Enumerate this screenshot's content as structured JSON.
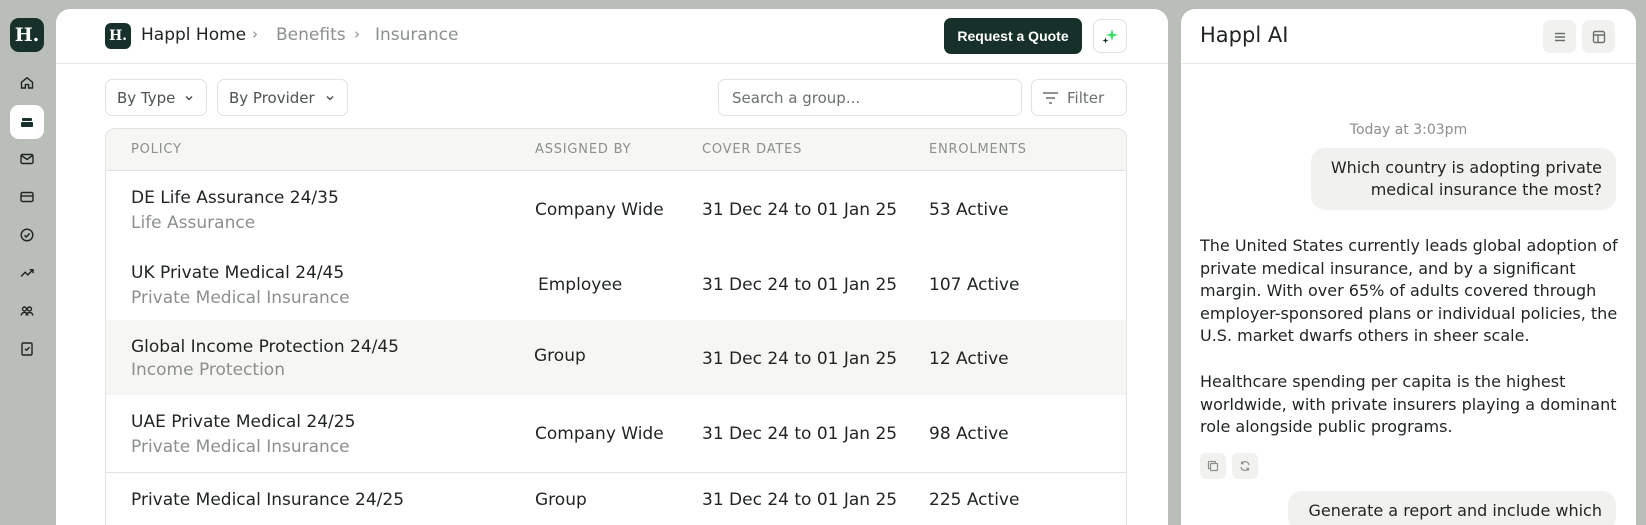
{
  "rail": {
    "logo": "H.",
    "items": [
      {
        "icon": "home-icon",
        "active": false
      },
      {
        "icon": "briefcase-icon",
        "active": true
      },
      {
        "icon": "mail-icon",
        "active": false
      },
      {
        "icon": "card-icon",
        "active": false
      },
      {
        "icon": "check-circle-icon",
        "active": false
      },
      {
        "icon": "trending-up-icon",
        "active": false
      },
      {
        "icon": "users-icon",
        "active": false
      },
      {
        "icon": "receipt-icon",
        "active": false
      }
    ]
  },
  "header": {
    "logo": "H.",
    "breadcrumb": [
      "Happl Home",
      "Benefits",
      "Insurance"
    ],
    "separator": "›",
    "quote_button": "Request a Quote",
    "accent": "#17302a"
  },
  "filters": {
    "by_type": "By Type",
    "by_provider": "By Provider",
    "search_placeholder": "Search a group...",
    "filter_label": "Filter"
  },
  "table": {
    "columns": [
      "POLICY",
      "ASSIGNED BY",
      "COVER DATES",
      "ENROLMENTS"
    ],
    "rows": [
      {
        "name": "DE Life Assurance 24/35",
        "type": "Life Assurance",
        "assigned_by": "Company Wide",
        "cover_dates": "31 Dec 24 to 01 Jan 25",
        "enrolments": "53 Active"
      },
      {
        "name": "UK Private Medical 24/45",
        "type": "Private Medical Insurance",
        "assigned_by": "Employee",
        "cover_dates": "31 Dec 24 to 01 Jan 25",
        "enrolments": "107 Active"
      },
      {
        "name": "Global Income Protection 24/45",
        "type": "Income Protection",
        "assigned_by": "Group",
        "cover_dates": "31 Dec 24 to 01 Jan 25",
        "enrolments": "12 Active"
      },
      {
        "name": "UAE Private Medical 24/25",
        "type": "Private Medical Insurance",
        "assigned_by": "Company Wide",
        "cover_dates": "31 Dec 24 to 01 Jan 25",
        "enrolments": "98 Active"
      },
      {
        "name": "Private Medical Insurance 24/25",
        "type": "",
        "assigned_by": "Group",
        "cover_dates": "31 Dec 24 to 01 Jan 25",
        "enrolments": "225 Active"
      }
    ]
  },
  "ai": {
    "title": "Happl AI",
    "timestamp": "Today at 3:03pm",
    "user_message": "Which country is adopting private medical insurance the most?",
    "reply_p1": "The United States currently leads global adoption of private medical insurance, and by a significant margin. With over 65% of adults covered through employer-sponsored plans or individual policies, the U.S. market dwarfs others in sheer scale.",
    "reply_p2": "Healthcare spending per capita is the highest worldwide, with private insurers playing a dominant role alongside public programs.",
    "user_message_2": "Generate a report and include which"
  }
}
